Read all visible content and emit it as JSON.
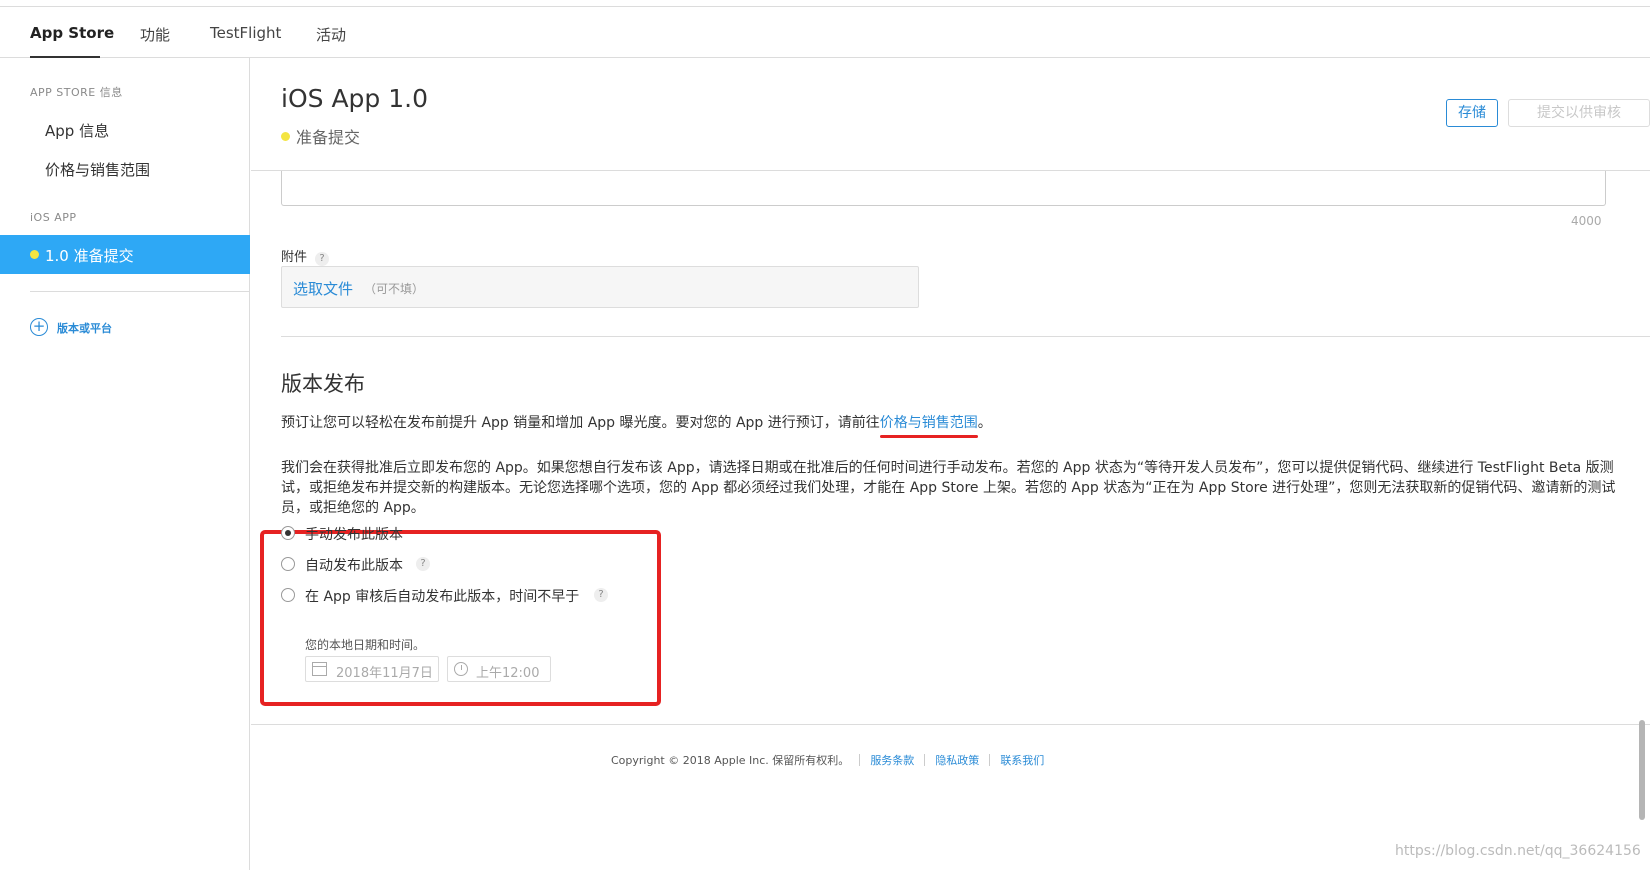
{
  "nav": {
    "tabs": [
      {
        "label": "App Store",
        "active": true
      },
      {
        "label": "功能",
        "active": false
      },
      {
        "label": "TestFlight",
        "active": false
      },
      {
        "label": "活动",
        "active": false
      }
    ]
  },
  "sidebar": {
    "section1_heading": "APP STORE 信息",
    "items": [
      {
        "label": "App 信息"
      },
      {
        "label": "价格与销售范围"
      }
    ],
    "section2_heading": "iOS APP",
    "active_version": "1.0 准备提交",
    "add_label": "版本或平台",
    "add_icon": "plus-circle-icon"
  },
  "main": {
    "title": "iOS App 1.0",
    "status": "准备提交",
    "save_label": "存储",
    "submit_label": "提交以供审核",
    "char_count": "4000",
    "attachment_label": "附件",
    "help_glyph": "?",
    "choose_file_label": "选取文件",
    "optional_label": "（可不填）",
    "release_title": "版本发布",
    "preorder_text_before": "预订让您可以轻松在发布前提升 App 销量和增加 App 曝光度。要对您的 App 进行预订，请前往",
    "preorder_link": "价格与销售范围",
    "preorder_text_after": "。",
    "release_description": "我们会在获得批准后立即发布您的 App。如果您想自行发布该 App，请选择日期或在批准后的任何时间进行手动发布。若您的 App 状态为“等待开发人员发布”，您可以提供促销代码、继续进行 TestFlight Beta 版测试，或拒绝发布并提交新的构建版本。无论您选择哪个选项，您的 App 都必须经过我们处理，才能在 App Store 上架。若您的 App 状态为“正在为 App Store 进行处理”，您则无法获取新的促销代码、邀请新的测试员，或拒绝您的 App。",
    "release_options": [
      {
        "label": "手动发布此版本",
        "checked": true
      },
      {
        "label": "自动发布此版本",
        "checked": false
      },
      {
        "label": "在 App 审核后自动发布此版本，时间不早于",
        "checked": false
      }
    ],
    "local_time_note": "您的本地日期和时间。",
    "date_value": "2018年11月7日",
    "time_value": "上午12:00"
  },
  "footer": {
    "copyright": "Copyright © 2018 Apple Inc. 保留所有权利。",
    "links": [
      "服务条款",
      "隐私政策",
      "联系我们"
    ]
  },
  "watermark": "https://blog.csdn.net/qq_36624156",
  "colors": {
    "accent": "#2a8bd6",
    "sidebar_active": "#2ea8f5",
    "status_dot": "#f4e542",
    "annotation_red": "#e62222"
  }
}
